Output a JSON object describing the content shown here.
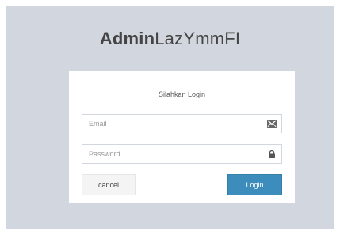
{
  "logo": {
    "bold": "Admin",
    "light": "LazYmmFI"
  },
  "login_box": {
    "message": "Silahkan Login",
    "email": {
      "placeholder": "Email",
      "value": "",
      "icon": "envelope-icon"
    },
    "password": {
      "placeholder": "Password",
      "value": "",
      "icon": "lock-icon"
    },
    "cancel_label": "cancel",
    "login_label": "Login"
  },
  "colors": {
    "background": "#d2d6de",
    "primary_button": "#3c8dbc",
    "default_button": "#f4f4f4",
    "logo_text": "#444444"
  }
}
